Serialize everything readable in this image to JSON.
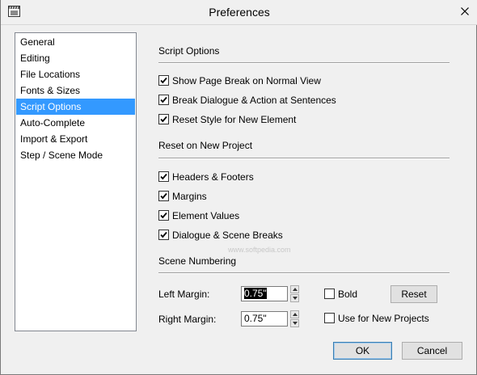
{
  "window": {
    "title": "Preferences"
  },
  "sidebar": {
    "items": [
      {
        "label": "General"
      },
      {
        "label": "Editing"
      },
      {
        "label": "File Locations"
      },
      {
        "label": "Fonts & Sizes"
      },
      {
        "label": "Script Options",
        "selected": true
      },
      {
        "label": "Auto-Complete"
      },
      {
        "label": "Import & Export"
      },
      {
        "label": "Step / Scene Mode"
      }
    ]
  },
  "script_options": {
    "title": "Script Options",
    "checkboxes": [
      {
        "label": "Show Page Break on Normal View",
        "checked": true
      },
      {
        "label": "Break Dialogue & Action at Sentences",
        "checked": true
      },
      {
        "label": "Reset Style for New Element",
        "checked": true
      }
    ]
  },
  "reset_project": {
    "title": "Reset on New Project",
    "checkboxes": [
      {
        "label": "Headers & Footers",
        "checked": true
      },
      {
        "label": "Margins",
        "checked": true
      },
      {
        "label": "Element Values",
        "checked": true
      },
      {
        "label": "Dialogue & Scene Breaks",
        "checked": true
      }
    ]
  },
  "scene_numbering": {
    "title": "Scene Numbering",
    "left_margin_label": "Left Margin:",
    "left_margin_value": "0.75\"",
    "right_margin_label": "Right Margin:",
    "right_margin_value": "0.75\"",
    "bold_label": "Bold",
    "bold_checked": false,
    "reset_label": "Reset",
    "use_new_label": "Use for New Projects",
    "use_new_checked": false
  },
  "footer": {
    "ok_label": "OK",
    "cancel_label": "Cancel"
  },
  "watermark": "www.softpedia.com",
  "colors": {
    "selection": "#3399ff",
    "background": "#f0f0f0"
  }
}
